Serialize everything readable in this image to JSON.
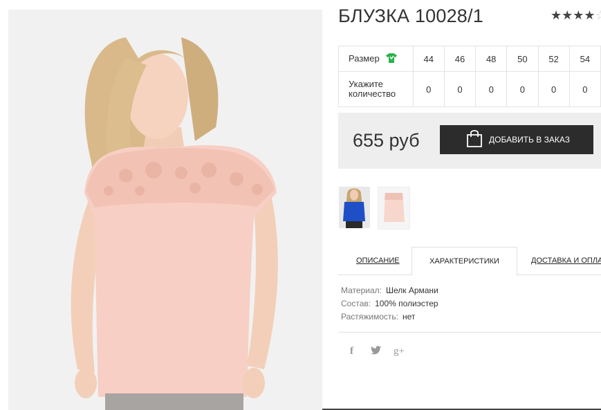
{
  "product": {
    "title": "БЛУЗКА 10028/1",
    "rating": 4,
    "rating_max": 5
  },
  "sizes": {
    "size_label": "Размер",
    "qty_label": "Укажите количество",
    "values": [
      "44",
      "46",
      "48",
      "50",
      "52",
      "54"
    ],
    "quantities": [
      "0",
      "0",
      "0",
      "0",
      "0",
      "0"
    ],
    "size_icon": "tshirt-icon"
  },
  "purchase": {
    "price": "655 руб",
    "add_button": "ДОБАВИТЬ В ЗАКАЗ",
    "button_icon": "shopping-bag-icon"
  },
  "tabs": {
    "description": "ОПИСАНИЕ",
    "characteristics": "ХАРАКТЕРИСТИКИ",
    "delivery": "ДОСТАВКА И ОПЛАТА",
    "active": "characteristics"
  },
  "specs": [
    {
      "key": "Материал:",
      "value": "Шелк Армани"
    },
    {
      "key": "Состав:",
      "value": "100% полиэстер"
    },
    {
      "key": "Растяжимость:",
      "value": "нет"
    }
  ],
  "social": {
    "facebook": "f",
    "twitter": "twitter-icon",
    "googleplus": "g+"
  },
  "colors": {
    "button_bg": "#2c2c2c",
    "price_box_bg": "#eeeeee",
    "size_icon_color": "#2bb24c",
    "blouse_pink": "#f7cfc4",
    "thumb_blue": "#1e4fc7"
  }
}
